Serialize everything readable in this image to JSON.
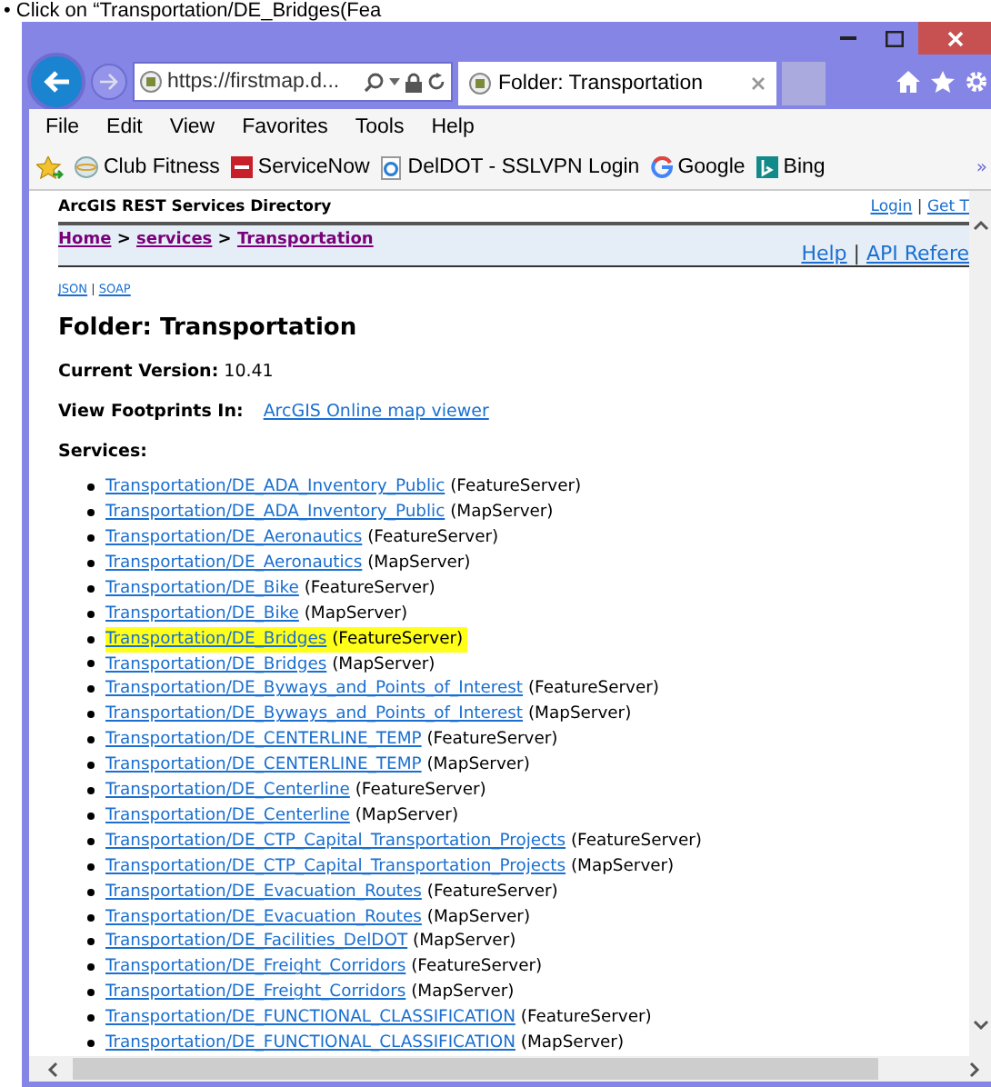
{
  "caption": "• Click on “Transportation/DE_Bridges(Fea",
  "browser": {
    "url": "https://firstmap.d...",
    "tab": {
      "title": "Folder: Transportation",
      "selected": true
    },
    "menu": [
      "File",
      "Edit",
      "View",
      "Favorites",
      "Tools",
      "Help"
    ],
    "favorites": [
      {
        "label": "Club Fitness",
        "kind": "globe"
      },
      {
        "label": "ServiceNow",
        "kind": "tile"
      },
      {
        "label": "DelDOT - SSLVPN Login",
        "kind": "page"
      },
      {
        "label": "Google",
        "kind": "letter"
      },
      {
        "label": "Bing",
        "kind": "square"
      }
    ],
    "overflow": "»"
  },
  "page": {
    "directory_title": "ArcGIS REST Services Directory",
    "header_links": [
      "Login",
      "Get T"
    ],
    "divider": "|",
    "breadcrumbs": [
      "Home",
      "services",
      "Transportation"
    ],
    "separator": ">",
    "help_links": [
      "Help",
      "API Refere"
    ],
    "format_links": [
      "JSON",
      "SOAP"
    ],
    "folder_title": "Folder: Transportation",
    "version_label": "Current Version:",
    "version": "10.41",
    "footprints_label": "View Footprints In:",
    "footprints_link": "ArcGIS Online map viewer",
    "services_label": "Services:",
    "services": [
      {
        "name": "Transportation/DE_ADA_Inventory_Public",
        "type": "(FeatureServer)",
        "highlighted": false
      },
      {
        "name": "Transportation/DE_ADA_Inventory_Public",
        "type": "(MapServer)",
        "highlighted": false
      },
      {
        "name": "Transportation/DE_Aeronautics",
        "type": "(FeatureServer)",
        "highlighted": false
      },
      {
        "name": "Transportation/DE_Aeronautics",
        "type": "(MapServer)",
        "highlighted": false
      },
      {
        "name": "Transportation/DE_Bike",
        "type": "(FeatureServer)",
        "highlighted": false
      },
      {
        "name": "Transportation/DE_Bike",
        "type": "(MapServer)",
        "highlighted": false
      },
      {
        "name": "Transportation/DE_Bridges",
        "type": "(FeatureServer)",
        "highlighted": true
      },
      {
        "name": "Transportation/DE_Bridges",
        "type": "(MapServer)",
        "highlighted": false
      },
      {
        "name": "Transportation/DE_Byways_and_Points_of_Interest",
        "type": "(FeatureServer)",
        "highlighted": false
      },
      {
        "name": "Transportation/DE_Byways_and_Points_of_Interest",
        "type": "(MapServer)",
        "highlighted": false
      },
      {
        "name": "Transportation/DE_CENTERLINE_TEMP",
        "type": "(FeatureServer)",
        "highlighted": false
      },
      {
        "name": "Transportation/DE_CENTERLINE_TEMP",
        "type": "(MapServer)",
        "highlighted": false
      },
      {
        "name": "Transportation/DE_Centerline",
        "type": "(FeatureServer)",
        "highlighted": false
      },
      {
        "name": "Transportation/DE_Centerline",
        "type": "(MapServer)",
        "highlighted": false
      },
      {
        "name": "Transportation/DE_CTP_Capital_Transportation_Projects",
        "type": "(FeatureServer)",
        "highlighted": false
      },
      {
        "name": "Transportation/DE_CTP_Capital_Transportation_Projects",
        "type": "(MapServer)",
        "highlighted": false
      },
      {
        "name": "Transportation/DE_Evacuation_Routes",
        "type": "(FeatureServer)",
        "highlighted": false
      },
      {
        "name": "Transportation/DE_Evacuation_Routes",
        "type": "(MapServer)",
        "highlighted": false
      },
      {
        "name": "Transportation/DE_Facilities_DelDOT",
        "type": "(MapServer)",
        "highlighted": false
      },
      {
        "name": "Transportation/DE_Freight_Corridors",
        "type": "(FeatureServer)",
        "highlighted": false
      },
      {
        "name": "Transportation/DE_Freight_Corridors",
        "type": "(MapServer)",
        "highlighted": false
      },
      {
        "name": "Transportation/DE_FUNCTIONAL_CLASSIFICATION",
        "type": "(FeatureServer)",
        "highlighted": false
      },
      {
        "name": "Transportation/DE_FUNCTIONAL_CLASSIFICATION",
        "type": "(MapServer)",
        "highlighted": false
      }
    ]
  }
}
